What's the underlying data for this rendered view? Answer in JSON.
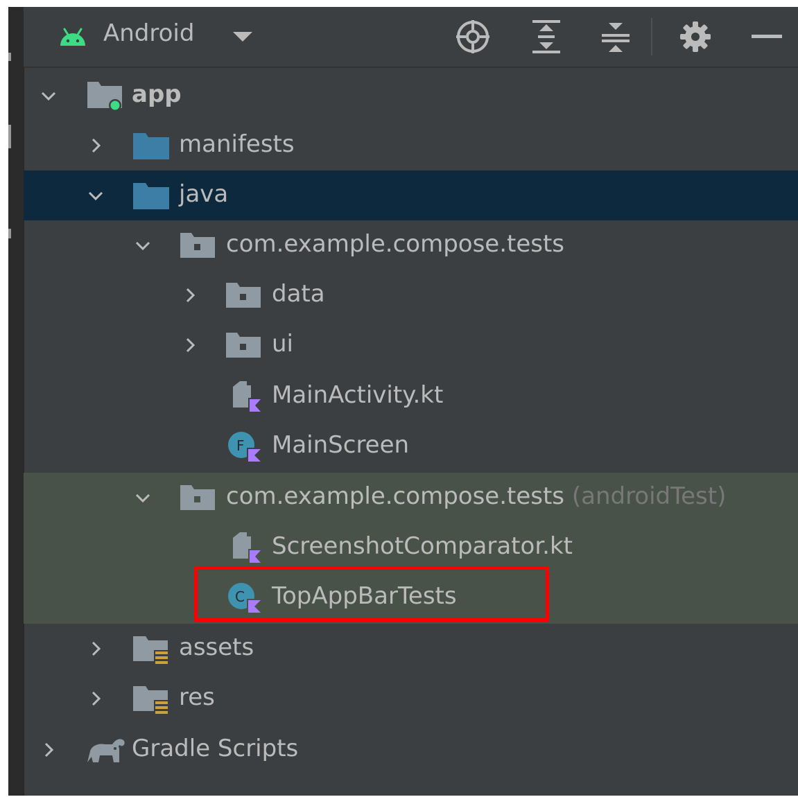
{
  "header": {
    "view_selector_label": "Android",
    "icons": [
      "android-icon",
      "chevron-down-icon",
      "locate-icon",
      "expand-all-icon",
      "collapse-all-icon",
      "gear-icon",
      "minimize-icon"
    ]
  },
  "tree": [
    {
      "label": "app",
      "bold": true,
      "expanded": true,
      "icon": "module-folder-icon"
    },
    {
      "label": "manifests",
      "expanded": false,
      "icon": "folder-icon"
    },
    {
      "label": "java",
      "expanded": true,
      "icon": "folder-icon",
      "selected": true
    },
    {
      "label": "com.example.compose.tests",
      "expanded": true,
      "icon": "package-icon"
    },
    {
      "label": "data",
      "expanded": false,
      "icon": "package-icon"
    },
    {
      "label": "ui",
      "expanded": false,
      "icon": "package-icon"
    },
    {
      "label": "MainActivity.kt",
      "icon": "kotlin-file-icon"
    },
    {
      "label": "MainScreen",
      "icon": "kotlin-class-icon"
    },
    {
      "label": "com.example.compose.tests",
      "suffix": "(androidTest)",
      "expanded": true,
      "icon": "package-icon"
    },
    {
      "label": "ScreenshotComparator.kt",
      "icon": "kotlin-file-icon"
    },
    {
      "label": "TopAppBarTests",
      "icon": "kotlin-class-icon",
      "highlighted": true
    },
    {
      "label": "assets",
      "expanded": false,
      "icon": "resource-folder-icon"
    },
    {
      "label": "res",
      "expanded": false,
      "icon": "resource-folder-icon"
    },
    {
      "label": "Gradle Scripts",
      "expanded": false,
      "icon": "gradle-icon"
    }
  ],
  "colors": {
    "panel_bg": "#3c3f41",
    "selection_bg": "#0d293e",
    "test_source_bg": "#495249",
    "text": "#bbbbbb",
    "suffix_text": "#787878",
    "folder_blue": "#3d7ea6",
    "android_green": "#3ddc84",
    "kotlin_purple": "#a97bff",
    "highlight_border": "#ff0000"
  }
}
